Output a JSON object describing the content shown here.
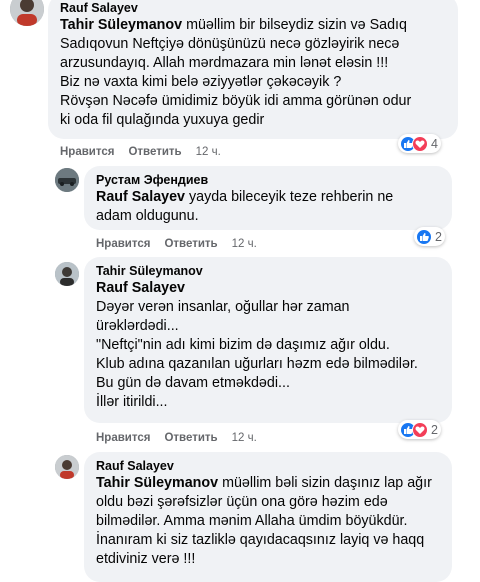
{
  "comments": [
    {
      "author": "Rauf Salayev",
      "mention": "Tahir Süleymanov",
      "lines": [
        " müəllim bir bilseydiz sizin və Sadıq",
        "Sadıqovun Neftçiyə dönüşünüzü necə gözləyirik necə",
        "arzusundayıq. Allah mərdmazara min lənət eləsin !!!",
        "Biz nə vaxta kimi belə əziyyətlər çəkəcəyik ?",
        "Rövşən Nəcəfə ümidimiz böyük idi amma görünən odur",
        "ki oda fil qulağında yuxuya gedir"
      ],
      "like": "Нравится",
      "reply": "Ответить",
      "time": "12 ч.",
      "reactions": "4"
    },
    {
      "author": "Рустам Эфендиев",
      "mention": "Rauf Salayev",
      "lines": [
        " yayda bileceyik teze rehberin ne",
        "adam oldugunu."
      ],
      "like": "Нравится",
      "reply": "Ответить",
      "time": "12 ч.",
      "reactions": "2"
    },
    {
      "author": "Tahir Süleymanov",
      "mention": "Rauf Salayev",
      "lines": [
        "Dəyər verən insanlar, oğullar hər zaman",
        "ürəklərdədi...",
        "\"Neftçi\"nin adı kimi bizim də daşımız ağır oldu.",
        "Klub adına qazanılan uğurları həzm edə bilmədilər.",
        "Bu gün də davam etməkdədi...",
        "İllər itirildi..."
      ],
      "like": "Нравится",
      "reply": "Ответить",
      "time": "12 ч.",
      "reactions": "2"
    },
    {
      "author": "Rauf Salayev",
      "mention": "Tahir Süleymanov",
      "lines": [
        " müəllim bəli sizin daşınız lap ağır",
        "oldu bəzi şərəfsizlər üçün ona görə həzim edə",
        "bilmədilər. Amma mənim Allaha ümdim böyükdür.",
        "İnanıram ki siz tazliklə qayıdacaqsınız layiq və haqq",
        "etdiviniz verə !!!"
      ]
    }
  ]
}
